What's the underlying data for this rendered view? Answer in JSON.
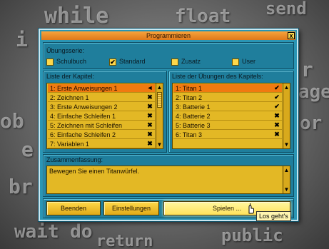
{
  "background_words": {
    "w1": "while",
    "w2": "float",
    "w3": "send",
    "w4": "wait do",
    "w5": "return",
    "w6": "public",
    "w7": "i",
    "w8": "ob",
    "w9": "e",
    "w10": "br",
    "w11": "r",
    "w12": "age",
    "w13": "or"
  },
  "window": {
    "title": "Programmieren",
    "close_glyph": "x"
  },
  "uebungsserie": {
    "label": "Übungsserie:",
    "options": [
      {
        "label": "Schulbuch",
        "checked": false
      },
      {
        "label": "Standard",
        "checked": true
      },
      {
        "label": "Zusatz",
        "checked": false
      },
      {
        "label": "User",
        "checked": false
      }
    ]
  },
  "kapitel": {
    "label": "Liste der Kapitel:",
    "items": [
      {
        "label": "1: Erste Anweisungen 1",
        "mark": "◄",
        "selected": true
      },
      {
        "label": "2: Zeichnen 1",
        "mark": "✖",
        "selected": false
      },
      {
        "label": "3: Erste Anweisungen 2",
        "mark": "✖",
        "selected": false
      },
      {
        "label": "4: Einfache Schleifen 1",
        "mark": "✖",
        "selected": false
      },
      {
        "label": "5: Zeichnen mit Schleifen",
        "mark": "✖",
        "selected": false
      },
      {
        "label": "6: Einfache Schleifen 2",
        "mark": "✖",
        "selected": false
      },
      {
        "label": "7: Variablen 1",
        "mark": "✖",
        "selected": false
      }
    ]
  },
  "uebungen": {
    "label": "Liste der Übungen des Kapitels:",
    "items": [
      {
        "label": "1: Titan 1",
        "mark": "✔",
        "selected": true
      },
      {
        "label": "2: Titan 2",
        "mark": "✔",
        "selected": false
      },
      {
        "label": "3: Batterie 1",
        "mark": "✔",
        "selected": false
      },
      {
        "label": "4: Batterie 2",
        "mark": "✖",
        "selected": false
      },
      {
        "label": "5: Batterie 3",
        "mark": "✖",
        "selected": false
      },
      {
        "label": "6: Titan 3",
        "mark": "✖",
        "selected": false
      }
    ]
  },
  "zusammenfassung": {
    "label": "Zusammenfassung:",
    "text": "Bewegen Sie einen Titanwürfel."
  },
  "scroll": {
    "up": "▲",
    "down": "▼"
  },
  "buttons": {
    "beenden": "Beenden",
    "einstellungen": "Einstellungen",
    "spielen": "Spielen ..."
  },
  "tooltip": "Los geht's",
  "colors": {
    "dialog_bg": "#2a95b4",
    "title_bar": "#f08a28",
    "list_bg": "#e3b825",
    "selected_item": "#f07a10",
    "button": "#f0c030"
  }
}
